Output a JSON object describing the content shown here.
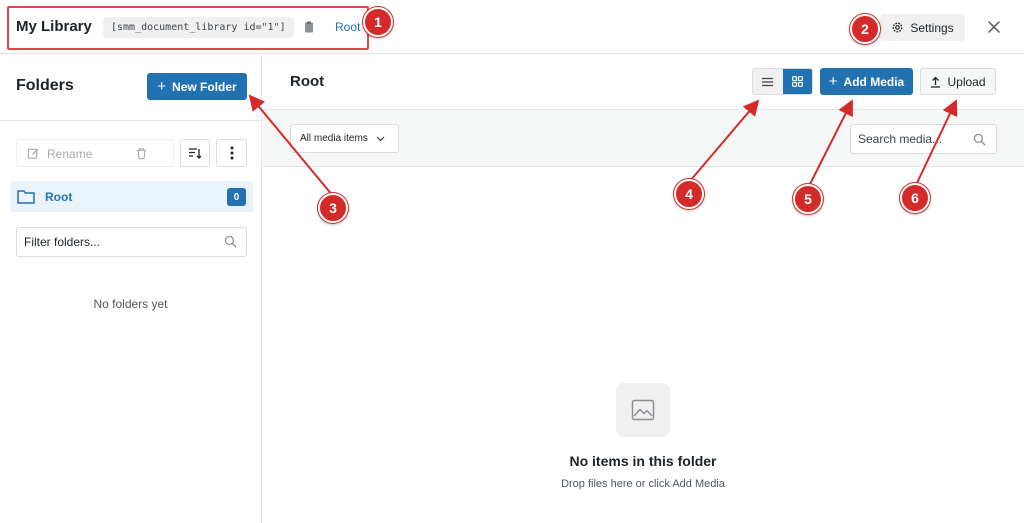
{
  "header": {
    "title": "My Library",
    "shortcode": "[smm_document_library id=\"1\"]",
    "breadcrumb": "Root",
    "settings_label": "Settings"
  },
  "sidebar": {
    "title": "Folders",
    "new_folder_label": "New Folder",
    "rename_label": "Rename",
    "folders": [
      {
        "name": "Root",
        "count": "0"
      }
    ],
    "filter_placeholder": "Filter folders...",
    "empty_text": "No folders yet"
  },
  "main": {
    "title": "Root",
    "add_media_label": "Add Media",
    "upload_label": "Upload",
    "filter_select": "All media items",
    "search_placeholder": "Search media...",
    "empty_title": "No items in this folder",
    "empty_subtitle": "Drop files here or click Add Media"
  },
  "annotations": {
    "markers": [
      "1",
      "2",
      "3",
      "4",
      "5",
      "6"
    ],
    "color": "#d52a2a"
  },
  "colors": {
    "accent": "#2271b1",
    "highlight_box": "#e2484b"
  }
}
